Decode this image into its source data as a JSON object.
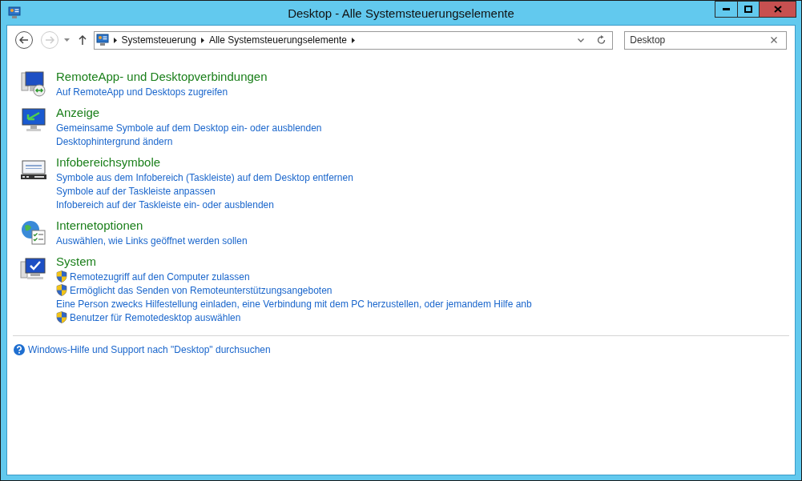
{
  "window": {
    "title": "Desktop - Alle Systemsteuerungselemente"
  },
  "nav": {
    "back_disabled": false,
    "forward_disabled": true
  },
  "breadcrumb": [
    "Systemsteuerung",
    "Alle Systemsteuerungselemente"
  ],
  "search": {
    "value": "Desktop"
  },
  "categories": [
    {
      "title": "RemoteApp- und Desktopverbindungen",
      "links": [
        {
          "text": "Auf RemoteApp und Desktops zugreifen",
          "shield": false
        }
      ]
    },
    {
      "title": "Anzeige",
      "links": [
        {
          "text": "Gemeinsame Symbole auf dem Desktop ein- oder ausblenden",
          "shield": false
        },
        {
          "text": "Desktophintergrund ändern",
          "shield": false
        }
      ]
    },
    {
      "title": "Infobereichsymbole",
      "links": [
        {
          "text": "Symbole aus dem Infobereich (Taskleiste) auf dem Desktop entfernen",
          "shield": false
        },
        {
          "text": "Symbole auf der Taskleiste anpassen",
          "shield": false
        },
        {
          "text": "Infobereich auf der Taskleiste ein- oder ausblenden",
          "shield": false
        }
      ]
    },
    {
      "title": "Internetoptionen",
      "links": [
        {
          "text": "Auswählen, wie Links geöffnet werden sollen",
          "shield": false
        }
      ]
    },
    {
      "title": "System",
      "links": [
        {
          "text": "Remotezugriff auf den Computer zulassen",
          "shield": true
        },
        {
          "text": "Ermöglicht das Senden von Remoteunterstützungsangeboten",
          "shield": true
        },
        {
          "text": "Eine Person zwecks Hilfestellung einladen, eine Verbindung mit dem PC herzustellen, oder jemandem Hilfe anb",
          "shield": false
        },
        {
          "text": "Benutzer für Remotedesktop auswählen",
          "shield": true
        }
      ]
    }
  ],
  "help_link": "Windows-Hilfe und Support nach \"Desktop\" durchsuchen"
}
